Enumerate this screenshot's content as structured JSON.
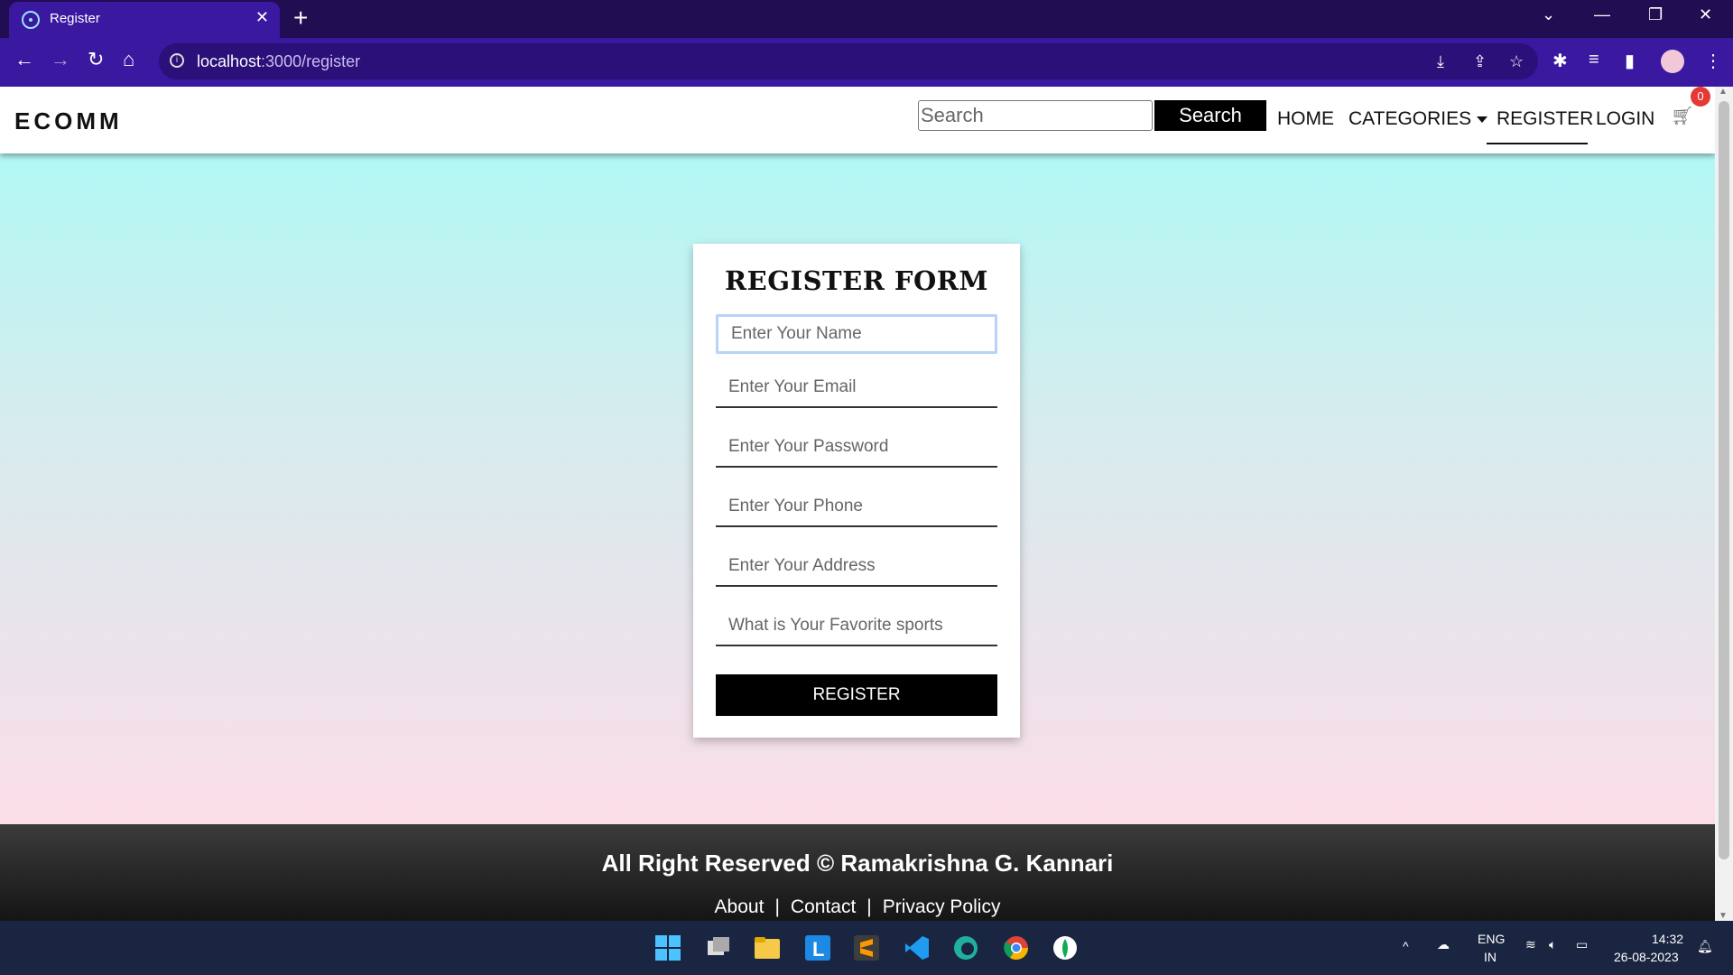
{
  "browser": {
    "tab_title": "Register",
    "tab_close": "✕",
    "new_tab": "+",
    "url_host": "localhost",
    "url_path": ":3000/register",
    "back": "←",
    "forward": "→",
    "reload": "↻",
    "home": "⌂"
  },
  "header": {
    "brand": "ECOMM",
    "search_placeholder": "Search",
    "search_button": "Search",
    "nav": {
      "home": "HOME",
      "categories": "CATEGORIES",
      "register": "REGISTER",
      "login": "LOGIN"
    },
    "cart_count": "0"
  },
  "form": {
    "title": "REGISTER FORM",
    "name_placeholder": "Enter Your Name",
    "email_placeholder": "Enter Your Email",
    "password_placeholder": "Enter Your Password",
    "phone_placeholder": "Enter Your Phone",
    "address_placeholder": "Enter Your Address",
    "answer_placeholder": "What is Your Favorite sports",
    "submit": "REGISTER"
  },
  "footer": {
    "copyright": "All Right Reserved © Ramakrishna G. Kannari",
    "links": [
      "About",
      "Contact",
      "Privacy Policy"
    ],
    "separator": "|"
  },
  "taskbar": {
    "lang_top": "ENG",
    "lang_bottom": "IN",
    "time": "14:32",
    "date": "26-08-2023"
  },
  "colors": {
    "browser_frame": "#200d52",
    "browser_toolbar": "#3a18a0",
    "gradient_top": "#b1f8f4",
    "gradient_bottom": "#fbdde8",
    "badge": "#e53935"
  }
}
